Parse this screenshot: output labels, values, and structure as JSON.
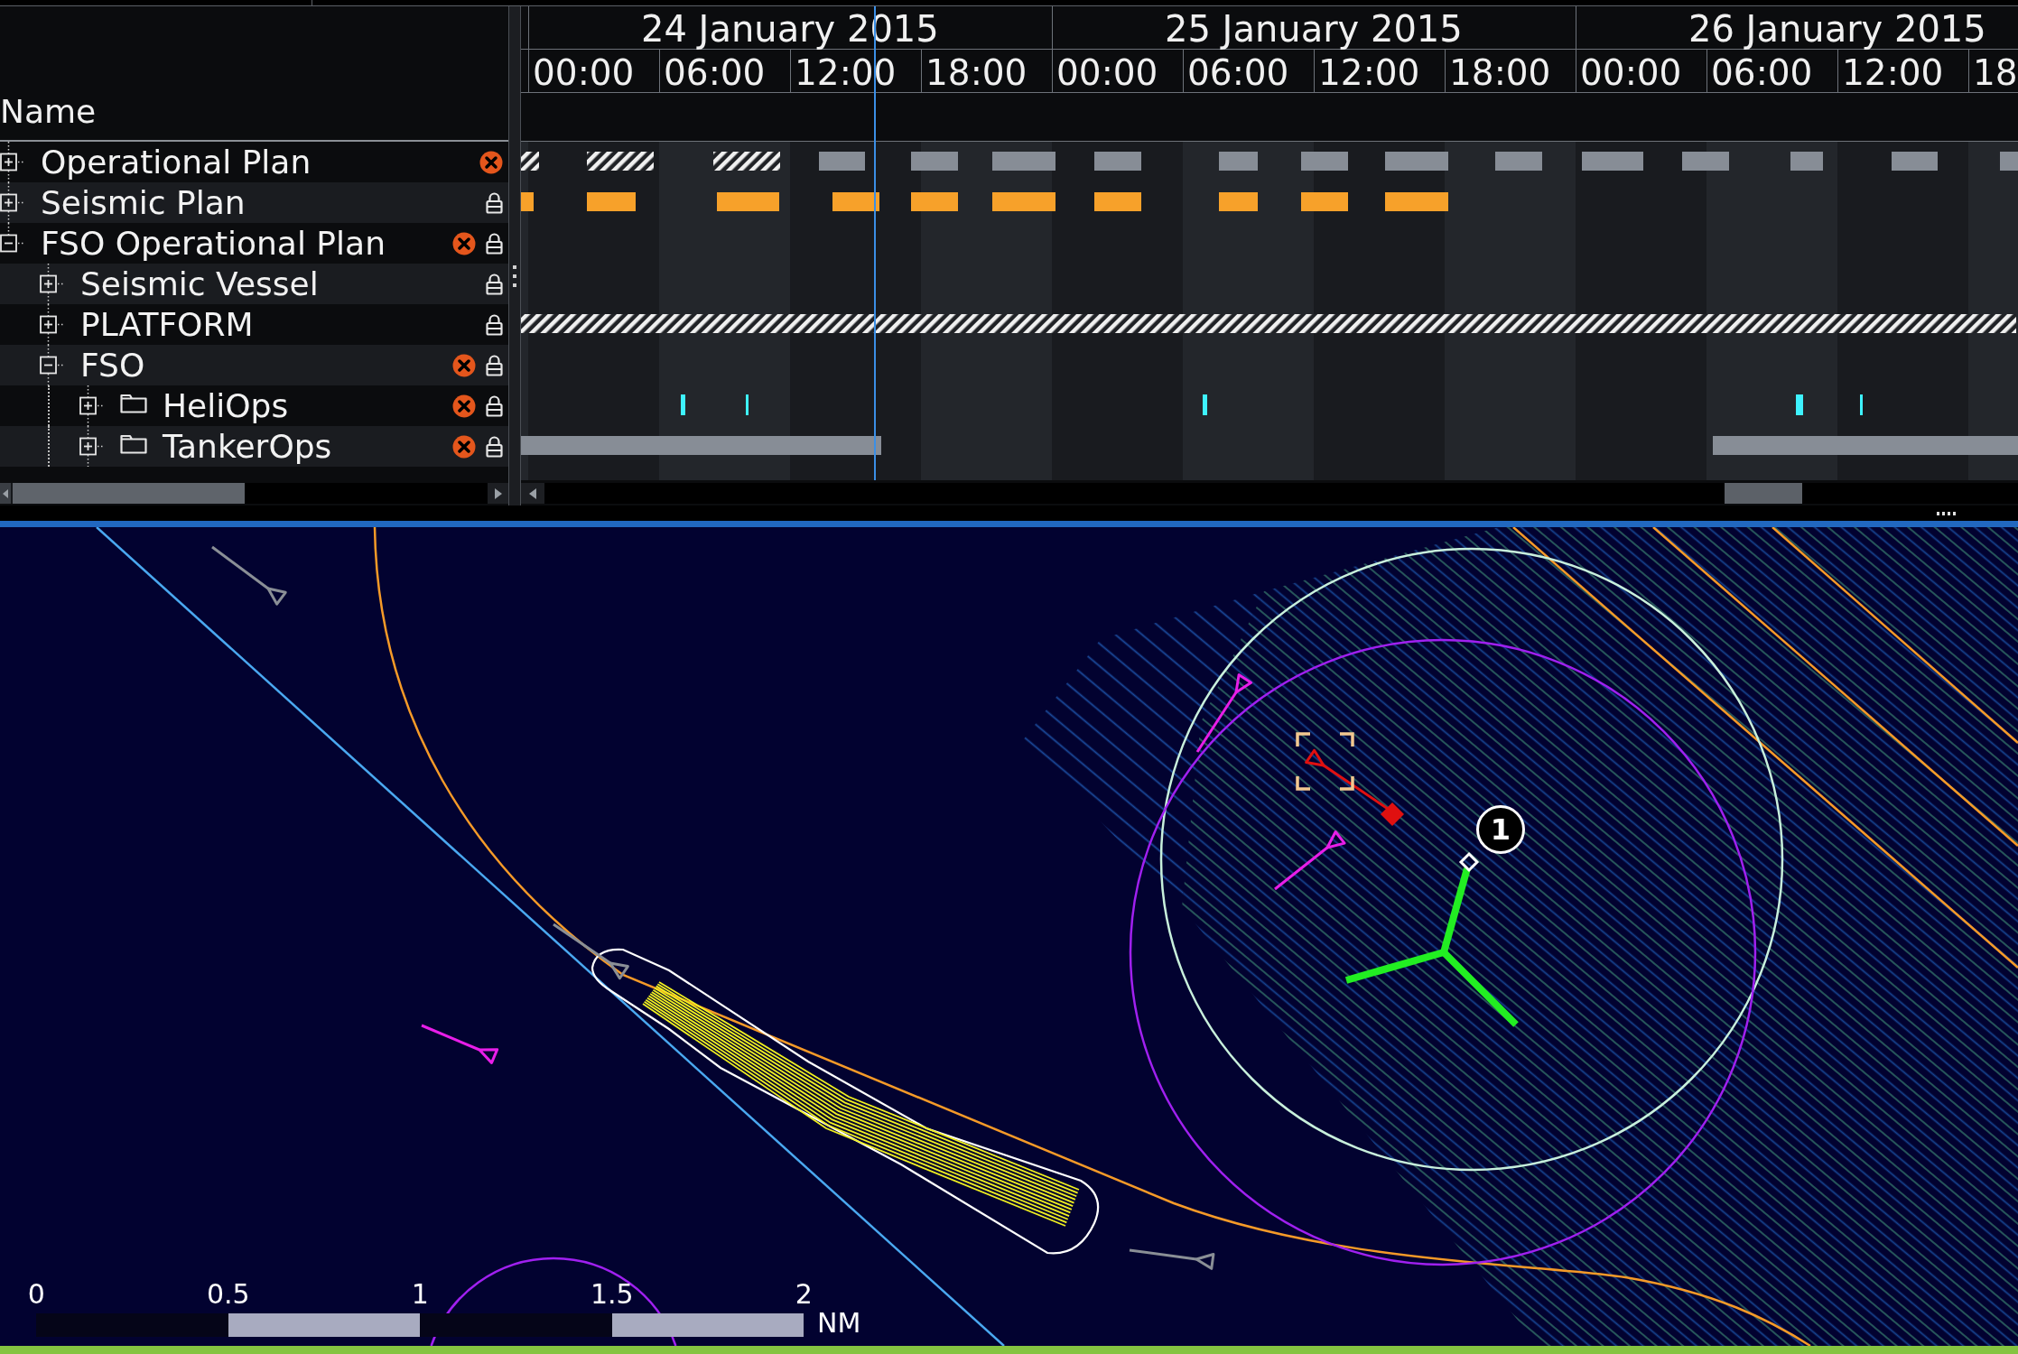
{
  "tree": {
    "header": "Name",
    "rows": [
      {
        "label": "Operational Plan",
        "folder": false,
        "expanded": false,
        "error": true,
        "locked": false
      },
      {
        "label": "Seismic Plan",
        "folder": false,
        "expanded": false,
        "error": false,
        "locked": true
      },
      {
        "label": "FSO Operational Plan",
        "folder": false,
        "expanded": true,
        "error": true,
        "locked": true,
        "children": [
          {
            "label": "Seismic Vessel",
            "folder": false,
            "expanded": false,
            "error": false,
            "locked": true
          },
          {
            "label": "PLATFORM",
            "folder": false,
            "expanded": false,
            "error": false,
            "locked": true
          },
          {
            "label": "FSO",
            "folder": false,
            "expanded": true,
            "error": true,
            "locked": true,
            "children": [
              {
                "label": "HeliOps",
                "folder": true,
                "expanded": false,
                "error": true,
                "locked": true
              },
              {
                "label": "TankerOps",
                "folder": true,
                "expanded": false,
                "error": true,
                "locked": true
              }
            ]
          }
        ]
      }
    ]
  },
  "timeline": {
    "days": [
      {
        "label": "24 January 2015",
        "hours": [
          "00:00",
          "06:00",
          "12:00",
          "18:00"
        ]
      },
      {
        "label": "25 January 2015",
        "hours": [
          "00:00",
          "06:00",
          "12:00",
          "18:00"
        ]
      },
      {
        "label": "26 January 2015",
        "hours": [
          "00:00",
          "06:00",
          "12:00",
          "18"
        ]
      }
    ]
  },
  "map": {
    "scale_bar": {
      "ticks": [
        "0",
        "0.5",
        "1",
        "1.5",
        "2"
      ],
      "unit": "NM"
    },
    "marker": {
      "label": "1"
    }
  }
}
